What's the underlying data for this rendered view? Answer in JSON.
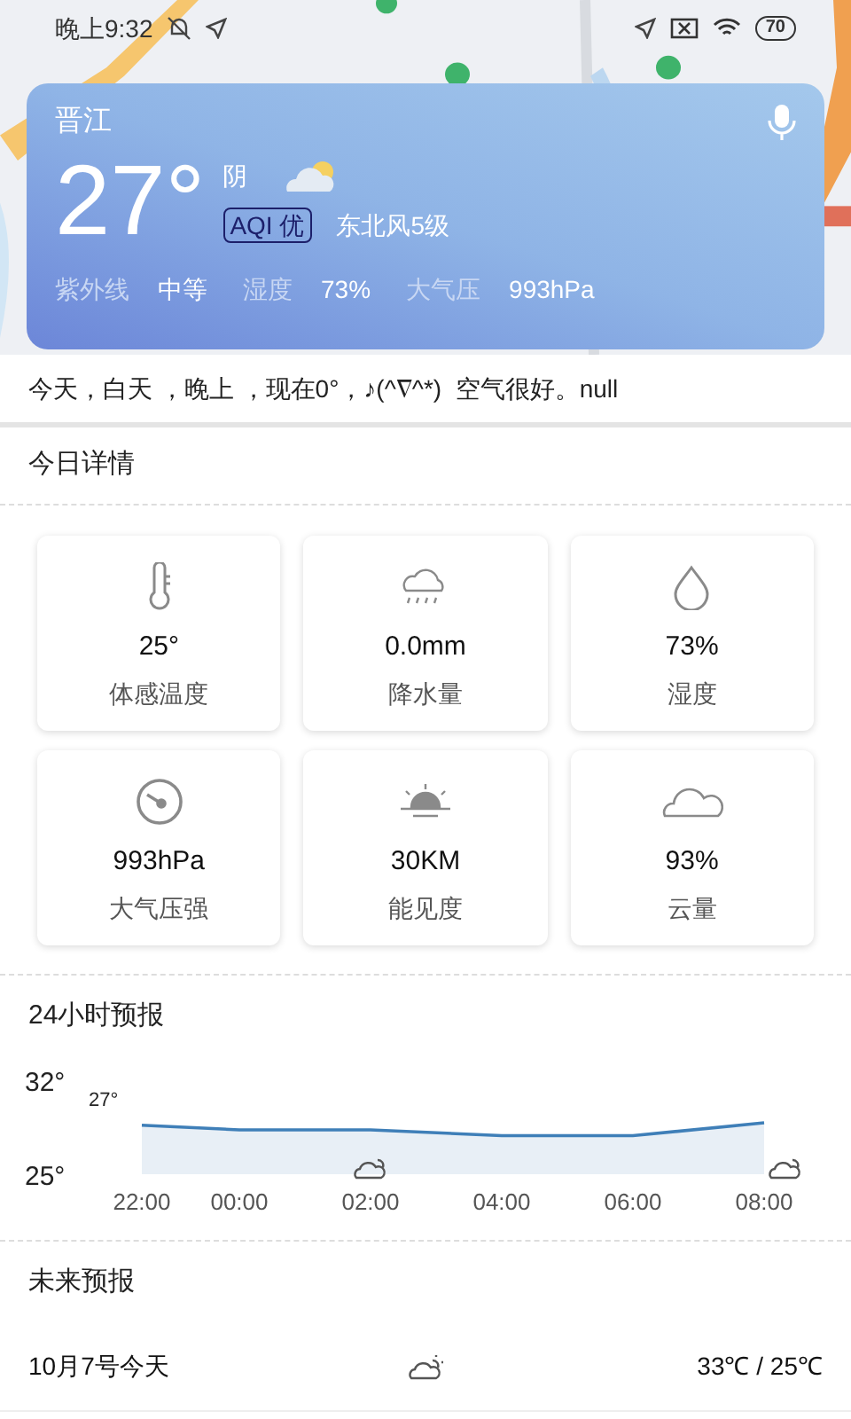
{
  "status_bar": {
    "time": "晚上9:32",
    "battery": "70"
  },
  "weather_card": {
    "city": "晋江",
    "temperature": "27°",
    "condition": "阴",
    "aqi": "AQI 优",
    "wind": "东北风5级",
    "stats": [
      {
        "label": "紫外线",
        "value": "中等"
      },
      {
        "label": "湿度",
        "value": "73%"
      },
      {
        "label": "大气压",
        "value": "993hPa"
      }
    ]
  },
  "summary": "今天，白天 ，晚上 ，现在0°，♪(^∇^*)  空气很好。null",
  "details": {
    "title": "今日详情",
    "items": [
      {
        "kind": "thermometer",
        "value": "25°",
        "label": "体感温度"
      },
      {
        "kind": "rain",
        "value": "0.0mm",
        "label": "降水量"
      },
      {
        "kind": "drop",
        "value": "73%",
        "label": "湿度"
      },
      {
        "kind": "gauge",
        "value": "993hPa",
        "label": "大气压强"
      },
      {
        "kind": "sunrise",
        "value": "30KM",
        "label": "能见度"
      },
      {
        "kind": "cloud",
        "value": "93%",
        "label": "云量"
      }
    ]
  },
  "hourly": {
    "title": "24小时预报",
    "chart_data": {
      "type": "area",
      "categories": [
        "22:00",
        "00:00",
        "02:00",
        "04:00",
        "06:00",
        "08:00"
      ],
      "series": [
        {
          "color": "#3f7fb8",
          "values": [
            28.6,
            28.2,
            28.2,
            27.7,
            27.7,
            28.8
          ]
        }
      ],
      "ylim": [
        25,
        32
      ],
      "yticks": [
        {
          "value": 32,
          "label": "32°"
        },
        {
          "value": 25,
          "label": "25°"
        }
      ],
      "annotations": [
        "27°"
      ]
    }
  },
  "forecast": {
    "title": "未来预报",
    "rows": [
      {
        "date": "10月7号今天",
        "temps": "33℃ / 25℃"
      }
    ]
  }
}
